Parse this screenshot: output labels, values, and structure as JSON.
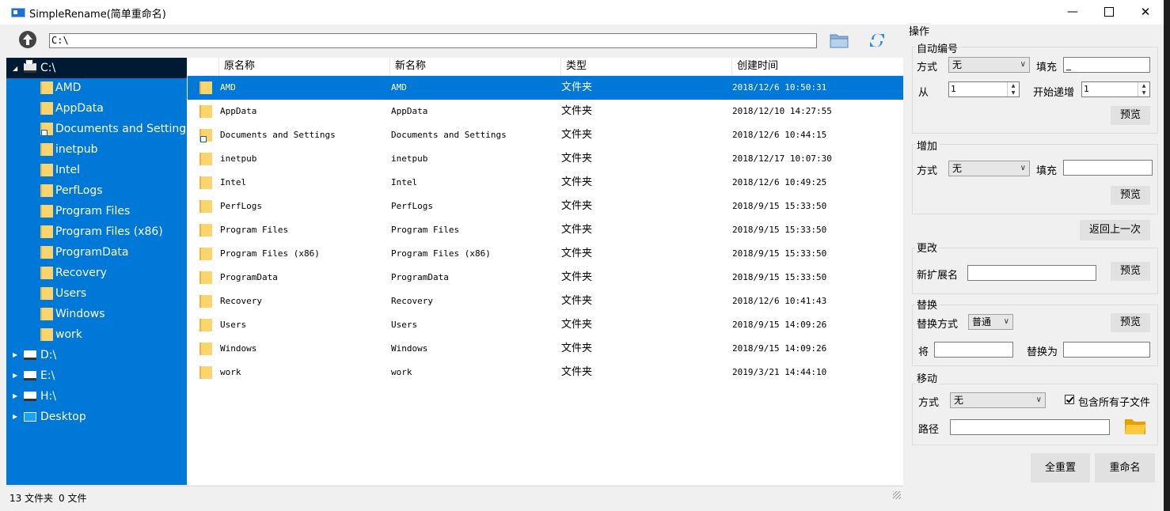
{
  "window": {
    "title": "SimpleRename(简单重命名)"
  },
  "toolbar": {
    "path": "C:\\"
  },
  "tree": {
    "root": "C:\\",
    "children": [
      "AMD",
      "AppData",
      "Documents and Settings",
      "inetpub",
      "Intel",
      "PerfLogs",
      "Program Files",
      "Program Files (x86)",
      "ProgramData",
      "Recovery",
      "Users",
      "Windows",
      "work"
    ],
    "drives": [
      "D:\\",
      "E:\\",
      "H:\\",
      "Desktop"
    ]
  },
  "list": {
    "columns": [
      "原名称",
      "新名称",
      "类型",
      "创建时间"
    ],
    "rows": [
      {
        "orig": "AMD",
        "new": "AMD",
        "type": "文件夹",
        "time": "2018/12/6 10:50:31"
      },
      {
        "orig": "AppData",
        "new": "AppData",
        "type": "文件夹",
        "time": "2018/12/10 14:27:55"
      },
      {
        "orig": "Documents and Settings",
        "new": "Documents and Settings",
        "type": "文件夹",
        "time": "2018/12/6 10:44:15"
      },
      {
        "orig": "inetpub",
        "new": "inetpub",
        "type": "文件夹",
        "time": "2018/12/17 10:07:30"
      },
      {
        "orig": "Intel",
        "new": "Intel",
        "type": "文件夹",
        "time": "2018/12/6 10:49:25"
      },
      {
        "orig": "PerfLogs",
        "new": "PerfLogs",
        "type": "文件夹",
        "time": "2018/9/15 15:33:50"
      },
      {
        "orig": "Program Files",
        "new": "Program Files",
        "type": "文件夹",
        "time": "2018/9/15 15:33:50"
      },
      {
        "orig": "Program Files (x86)",
        "new": "Program Files (x86)",
        "type": "文件夹",
        "time": "2018/9/15 15:33:50"
      },
      {
        "orig": "ProgramData",
        "new": "ProgramData",
        "type": "文件夹",
        "time": "2018/9/15 15:33:50"
      },
      {
        "orig": "Recovery",
        "new": "Recovery",
        "type": "文件夹",
        "time": "2018/12/6 10:41:43"
      },
      {
        "orig": "Users",
        "new": "Users",
        "type": "文件夹",
        "time": "2018/9/15 14:09:26"
      },
      {
        "orig": "Windows",
        "new": "Windows",
        "type": "文件夹",
        "time": "2018/9/15 14:09:26"
      },
      {
        "orig": "work",
        "new": "work",
        "type": "文件夹",
        "time": "2019/3/21 14:44:10"
      }
    ]
  },
  "status": {
    "folders": "13 文件夹",
    "files": "0 文件"
  },
  "panel": {
    "title": "操作",
    "auto": {
      "title": "自动编号",
      "mode_label": "方式",
      "mode": "无",
      "fill_label": "填充",
      "fill": "_",
      "from_label": "从",
      "from": "1",
      "step_label": "开始递增",
      "step": "1",
      "preview": "预览"
    },
    "add": {
      "title": "增加",
      "mode_label": "方式",
      "mode": "无",
      "fill_label": "填充",
      "fill": "",
      "preview": "预览"
    },
    "undo": "返回上一次",
    "change": {
      "title": "更改",
      "ext_label": "新扩展名",
      "ext": "",
      "preview": "预览"
    },
    "replace": {
      "title": "替换",
      "mode_label": "替换方式",
      "mode": "普通",
      "preview": "预览",
      "from_label": "将",
      "from": "",
      "to_label": "替换为",
      "to": ""
    },
    "move": {
      "title": "移动",
      "mode_label": "方式",
      "mode": "无",
      "include_label": "包含所有子文件",
      "path_label": "路径",
      "path": ""
    },
    "reset": "全重置",
    "rename": "重命名"
  }
}
